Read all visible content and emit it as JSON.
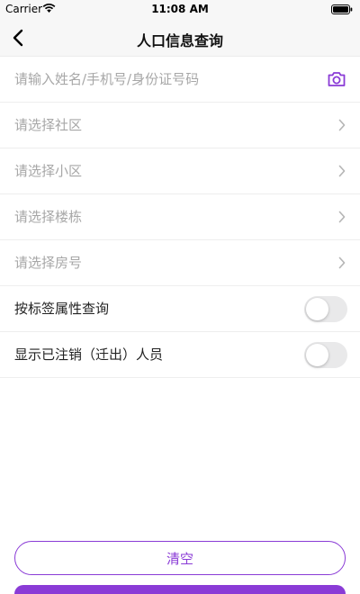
{
  "status_bar": {
    "carrier": "Carrier",
    "time": "11:08 AM"
  },
  "nav": {
    "title": "人口信息查询"
  },
  "form": {
    "search_placeholder": "请输入姓名/手机号/身份证号码",
    "community_placeholder": "请选择社区",
    "estate_placeholder": "请选择小区",
    "building_placeholder": "请选择楼栋",
    "room_placeholder": "请选择房号",
    "tag_query_label": "按标签属性查询",
    "tag_query_on": false,
    "show_cancelled_label": "显示已注销（迁出）人员",
    "show_cancelled_on": false
  },
  "actions": {
    "clear_label": "清空"
  },
  "colors": {
    "accent": "#8a3bd6",
    "placeholder": "#a7a7a7",
    "divider": "#eeeeee"
  },
  "icons": {
    "back": "chevron-left-icon",
    "camera": "camera-icon",
    "chevron": "chevron-right-icon",
    "wifi": "wifi-icon",
    "battery": "battery-icon"
  }
}
